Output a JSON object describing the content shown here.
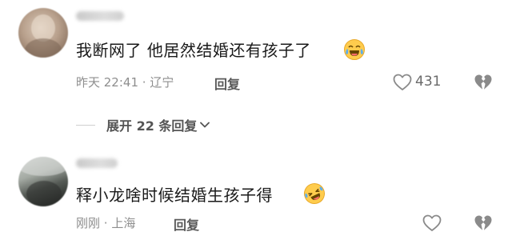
{
  "comments": [
    {
      "text": "我断网了 他居然结婚还有孩子了",
      "emoji": "crying-laughing-emoji",
      "time": "昨天 22:41",
      "location": "辽宁",
      "reply_label": "回复",
      "like_count": "431"
    },
    {
      "text": "释小龙啥时候结婚生孩子得",
      "emoji": "rolling-laughing-emoji",
      "time": "刚刚",
      "location": "上海",
      "reply_label": "回复",
      "like_count": ""
    }
  ],
  "expand_replies": {
    "label": "展开 22 条回复"
  },
  "colors": {
    "text": "#1a1a1a",
    "meta": "#8e8e8e",
    "icon": "#8a8a8a"
  }
}
